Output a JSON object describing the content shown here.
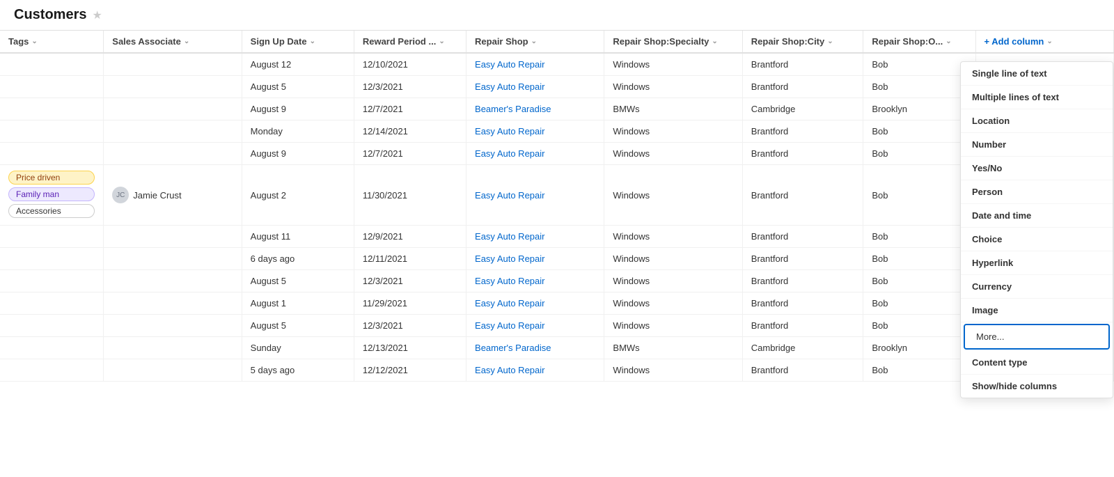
{
  "header": {
    "title": "Customers",
    "star_icon": "★"
  },
  "columns": [
    {
      "id": "tags",
      "label": "Tags",
      "sortable": true
    },
    {
      "id": "sales",
      "label": "Sales Associate",
      "sortable": true
    },
    {
      "id": "signup",
      "label": "Sign Up Date",
      "sortable": true
    },
    {
      "id": "reward",
      "label": "Reward Period ...",
      "sortable": true
    },
    {
      "id": "shop",
      "label": "Repair Shop",
      "sortable": true
    },
    {
      "id": "specialty",
      "label": "Repair Shop:Specialty",
      "sortable": true
    },
    {
      "id": "city",
      "label": "Repair Shop:City",
      "sortable": true
    },
    {
      "id": "owner",
      "label": "Repair Shop:O...",
      "sortable": true
    },
    {
      "id": "add",
      "label": "+ Add column",
      "sortable": false
    }
  ],
  "rows": [
    {
      "tags": [],
      "sales": "",
      "signup": "August 12",
      "reward": "12/10/2021",
      "shop": "Easy Auto Repair",
      "specialty": "Windows",
      "city": "Brantford",
      "owner": "Bob"
    },
    {
      "tags": [],
      "sales": "",
      "signup": "August 5",
      "reward": "12/3/2021",
      "shop": "Easy Auto Repair",
      "specialty": "Windows",
      "city": "Brantford",
      "owner": "Bob"
    },
    {
      "tags": [],
      "sales": "",
      "signup": "August 9",
      "reward": "12/7/2021",
      "shop": "Beamer's Paradise",
      "specialty": "BMWs",
      "city": "Cambridge",
      "owner": "Brooklyn"
    },
    {
      "tags": [],
      "sales": "",
      "signup": "Monday",
      "reward": "12/14/2021",
      "shop": "Easy Auto Repair",
      "specialty": "Windows",
      "city": "Brantford",
      "owner": "Bob"
    },
    {
      "tags": [],
      "sales": "",
      "signup": "August 9",
      "reward": "12/7/2021",
      "shop": "Easy Auto Repair",
      "specialty": "Windows",
      "city": "Brantford",
      "owner": "Bob"
    },
    {
      "tags": [
        "Price driven",
        "Family man",
        "Accessories"
      ],
      "sales": "Jamie Crust",
      "signup": "August 2",
      "reward": "11/30/2021",
      "shop": "Easy Auto Repair",
      "specialty": "Windows",
      "city": "Brantford",
      "owner": "Bob"
    },
    {
      "tags": [],
      "sales": "",
      "signup": "August 11",
      "reward": "12/9/2021",
      "shop": "Easy Auto Repair",
      "specialty": "Windows",
      "city": "Brantford",
      "owner": "Bob"
    },
    {
      "tags": [],
      "sales": "",
      "signup": "6 days ago",
      "reward": "12/11/2021",
      "shop": "Easy Auto Repair",
      "specialty": "Windows",
      "city": "Brantford",
      "owner": "Bob"
    },
    {
      "tags": [],
      "sales": "",
      "signup": "August 5",
      "reward": "12/3/2021",
      "shop": "Easy Auto Repair",
      "specialty": "Windows",
      "city": "Brantford",
      "owner": "Bob"
    },
    {
      "tags": [],
      "sales": "",
      "signup": "August 1",
      "reward": "11/29/2021",
      "shop": "Easy Auto Repair",
      "specialty": "Windows",
      "city": "Brantford",
      "owner": "Bob"
    },
    {
      "tags": [],
      "sales": "",
      "signup": "August 5",
      "reward": "12/3/2021",
      "shop": "Easy Auto Repair",
      "specialty": "Windows",
      "city": "Brantford",
      "owner": "Bob"
    },
    {
      "tags": [],
      "sales": "",
      "signup": "Sunday",
      "reward": "12/13/2021",
      "shop": "Beamer's Paradise",
      "specialty": "BMWs",
      "city": "Cambridge",
      "owner": "Brooklyn"
    },
    {
      "tags": [],
      "sales": "",
      "signup": "5 days ago",
      "reward": "12/12/2021",
      "shop": "Easy Auto Repair",
      "specialty": "Windows",
      "city": "Brantford",
      "owner": "Bob"
    }
  ],
  "dropdown": {
    "items": [
      {
        "id": "single-line",
        "label": "Single line of text"
      },
      {
        "id": "multi-line",
        "label": "Multiple lines of text"
      },
      {
        "id": "location",
        "label": "Location"
      },
      {
        "id": "number",
        "label": "Number"
      },
      {
        "id": "yes-no",
        "label": "Yes/No"
      },
      {
        "id": "person",
        "label": "Person"
      },
      {
        "id": "date-time",
        "label": "Date and time"
      },
      {
        "id": "choice",
        "label": "Choice"
      },
      {
        "id": "hyperlink",
        "label": "Hyperlink"
      },
      {
        "id": "currency",
        "label": "Currency"
      },
      {
        "id": "image",
        "label": "Image"
      },
      {
        "id": "more",
        "label": "More..."
      },
      {
        "id": "content-type",
        "label": "Content type"
      },
      {
        "id": "show-hide",
        "label": "Show/hide columns"
      }
    ]
  },
  "tag_styles": {
    "Price driven": "yellow",
    "Family man": "purple",
    "Accessories": "outline"
  }
}
